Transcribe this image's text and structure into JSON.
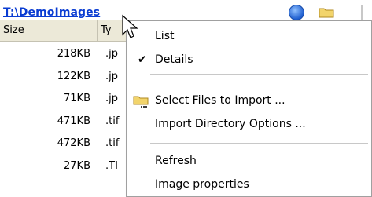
{
  "path": "T:\\DemoImages",
  "columns": {
    "size": "Size",
    "type": "Ty"
  },
  "rows": [
    {
      "size": "218KB",
      "type": ".jp"
    },
    {
      "size": "122KB",
      "type": ".jp"
    },
    {
      "size": "71KB",
      "type": ".jp"
    },
    {
      "size": "471KB",
      "type": ".tif"
    },
    {
      "size": "472KB",
      "type": ".tif"
    },
    {
      "size": "27KB",
      "type": ".TI"
    }
  ],
  "menu": {
    "list": "List",
    "details": "Details",
    "details_check": "✔",
    "select_files": "Select Files to Import ...",
    "import_dir": "Import Directory Options ...",
    "refresh": "Refresh",
    "image_props": "Image properties"
  },
  "icons": {
    "nav": "navigation-icon",
    "folder": "folder-icon"
  },
  "colors": {
    "link": "#0a3cd2",
    "header_bg": "#ece9d8",
    "menu_border": "#a0a0a0"
  }
}
